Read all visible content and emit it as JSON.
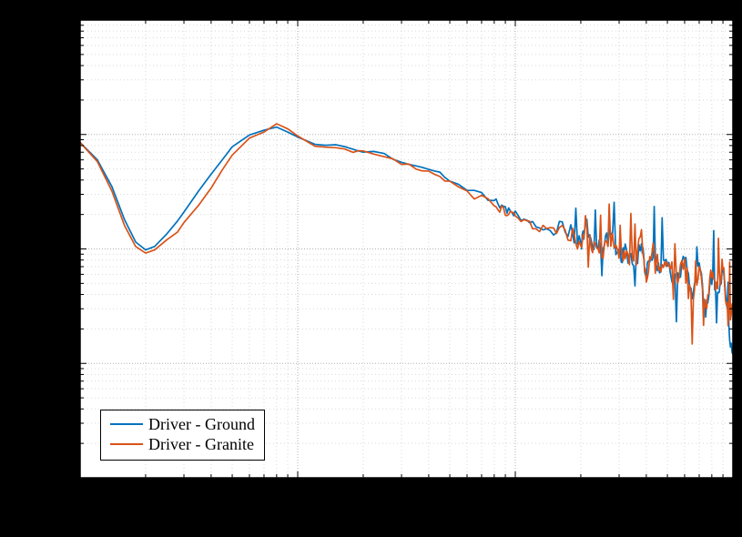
{
  "chart_data": {
    "type": "line",
    "xscale": "log",
    "yscale": "log",
    "title": "",
    "xlabel": "",
    "ylabel": "",
    "xlim": [
      10,
      10000
    ],
    "ylim": [
      0.0001,
      1
    ],
    "plot_background": "#ffffff",
    "series": [
      {
        "name": "Driver - Ground",
        "color": "#0072BD",
        "x": [
          10,
          12,
          14,
          16,
          18,
          20,
          22,
          25,
          28,
          30,
          35,
          40,
          45,
          50,
          60,
          70,
          80,
          90,
          100,
          120,
          150,
          180,
          200,
          250,
          300,
          350,
          400,
          450,
          500,
          600,
          700,
          800,
          900,
          1000,
          1200,
          1500,
          1800,
          2000,
          2100,
          2300,
          2500,
          2700,
          3000,
          3200,
          3500,
          3800,
          4000,
          4300,
          4600,
          5000,
          5500,
          6000,
          6500,
          7000,
          7500,
          8000,
          8500,
          9000,
          9500,
          10000
        ],
        "y": [
          0.085,
          0.06,
          0.035,
          0.018,
          0.0115,
          0.0098,
          0.0105,
          0.0135,
          0.0175,
          0.021,
          0.032,
          0.045,
          0.06,
          0.078,
          0.099,
          0.109,
          0.116,
          0.105,
          0.095,
          0.082,
          0.079,
          0.074,
          0.072,
          0.068,
          0.058,
          0.053,
          0.049,
          0.046,
          0.04,
          0.033,
          0.029,
          0.026,
          0.023,
          0.02,
          0.016,
          0.0155,
          0.014,
          0.011,
          0.0175,
          0.01,
          0.0098,
          0.0135,
          0.0087,
          0.0095,
          0.0075,
          0.011,
          0.006,
          0.0098,
          0.0062,
          0.0075,
          0.0048,
          0.0082,
          0.0038,
          0.0065,
          0.003,
          0.0058,
          0.0041,
          0.0068,
          0.0022,
          0.0012
        ]
      },
      {
        "name": "Driver - Granite",
        "color": "#D95319",
        "x": [
          10,
          12,
          14,
          16,
          18,
          20,
          22,
          25,
          28,
          30,
          35,
          40,
          45,
          50,
          60,
          70,
          80,
          90,
          100,
          120,
          150,
          180,
          200,
          250,
          300,
          350,
          400,
          450,
          500,
          600,
          700,
          800,
          900,
          1000,
          1200,
          1500,
          1800,
          2000,
          2100,
          2300,
          2500,
          2700,
          3000,
          3200,
          3500,
          3800,
          4000,
          4300,
          4600,
          5000,
          5500,
          6000,
          6500,
          7000,
          7500,
          8000,
          8500,
          9000,
          9500,
          10000
        ],
        "y": [
          0.085,
          0.058,
          0.032,
          0.016,
          0.0105,
          0.0092,
          0.0098,
          0.012,
          0.014,
          0.017,
          0.024,
          0.034,
          0.049,
          0.066,
          0.093,
          0.105,
          0.124,
          0.112,
          0.097,
          0.079,
          0.076,
          0.071,
          0.07,
          0.064,
          0.056,
          0.051,
          0.047,
          0.043,
          0.038,
          0.031,
          0.028,
          0.024,
          0.021,
          0.019,
          0.0155,
          0.015,
          0.0135,
          0.0105,
          0.0168,
          0.0096,
          0.0092,
          0.0128,
          0.0083,
          0.009,
          0.0071,
          0.0132,
          0.0057,
          0.0105,
          0.0066,
          0.008,
          0.0051,
          0.009,
          0.0033,
          0.0072,
          0.0027,
          0.0063,
          0.0044,
          0.0075,
          0.0025,
          0.003
        ]
      }
    ]
  },
  "legend": {
    "items": [
      {
        "swatch_color": "#0072BD",
        "label": "Driver - Ground"
      },
      {
        "swatch_color": "#D95319",
        "label": "Driver - Granite"
      }
    ]
  }
}
